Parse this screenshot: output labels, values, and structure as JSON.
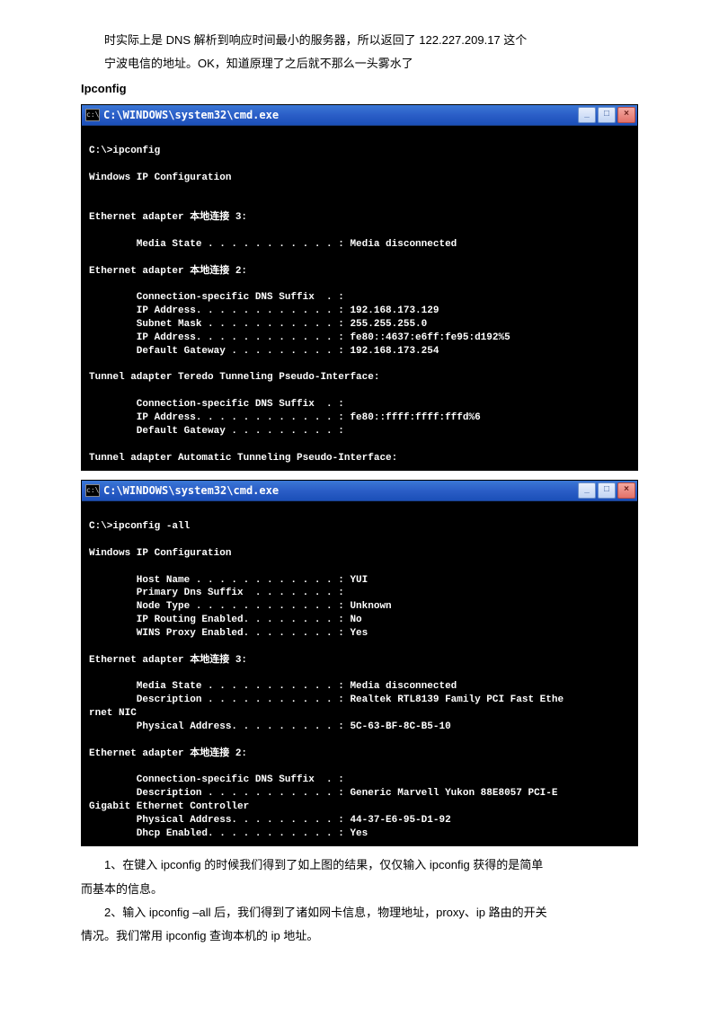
{
  "intro": {
    "line1": "时实际上是 DNS 解析到响应时间最小的服务器，所以返回了 122.227.209.17 这个",
    "line2": "宁波电信的地址。OK，知道原理了之后就不那么一头雾水了"
  },
  "section1_title": "Ipconfig",
  "cmd1": {
    "title": "C:\\WINDOWS\\system32\\cmd.exe",
    "btn_min": "_",
    "btn_max": "□",
    "btn_close": "×",
    "body": "\nC:\\>ipconfig\n\nWindows IP Configuration\n\n\nEthernet adapter 本地连接 3:\n\n        Media State . . . . . . . . . . . : Media disconnected\n\nEthernet adapter 本地连接 2:\n\n        Connection-specific DNS Suffix  . :\n        IP Address. . . . . . . . . . . . : 192.168.173.129\n        Subnet Mask . . . . . . . . . . . : 255.255.255.0\n        IP Address. . . . . . . . . . . . : fe80::4637:e6ff:fe95:d192%5\n        Default Gateway . . . . . . . . . : 192.168.173.254\n\nTunnel adapter Teredo Tunneling Pseudo-Interface:\n\n        Connection-specific DNS Suffix  . :\n        IP Address. . . . . . . . . . . . : fe80::ffff:ffff:fffd%6\n        Default Gateway . . . . . . . . . :\n\nTunnel adapter Automatic Tunneling Pseudo-Interface:"
  },
  "cmd2": {
    "title": "C:\\WINDOWS\\system32\\cmd.exe",
    "btn_min": "_",
    "btn_max": "□",
    "btn_close": "×",
    "body": "\nC:\\>ipconfig -all\n\nWindows IP Configuration\n\n        Host Name . . . . . . . . . . . . : YUI\n        Primary Dns Suffix  . . . . . . . :\n        Node Type . . . . . . . . . . . . : Unknown\n        IP Routing Enabled. . . . . . . . : No\n        WINS Proxy Enabled. . . . . . . . : Yes\n\nEthernet adapter 本地连接 3:\n\n        Media State . . . . . . . . . . . : Media disconnected\n        Description . . . . . . . . . . . : Realtek RTL8139 Family PCI Fast Ethe\nrnet NIC\n        Physical Address. . . . . . . . . : 5C-63-BF-8C-B5-10\n\nEthernet adapter 本地连接 2:\n\n        Connection-specific DNS Suffix  . :\n        Description . . . . . . . . . . . : Generic Marvell Yukon 88E8057 PCI-E\nGigabit Ethernet Controller\n        Physical Address. . . . . . . . . : 44-37-E6-95-D1-92\n        Dhcp Enabled. . . . . . . . . . . : Yes"
  },
  "outro": {
    "line1": "1、在键入 ipconfig 的时候我们得到了如上图的结果，仅仅输入 ipconfig 获得的是简单",
    "line2": "而基本的信息。",
    "line3": "2、输入 ipconfig –all 后，我们得到了诸如网卡信息，物理地址，proxy、ip 路由的开关",
    "line4": "情况。我们常用 ipconfig 查询本机的 ip 地址。"
  }
}
